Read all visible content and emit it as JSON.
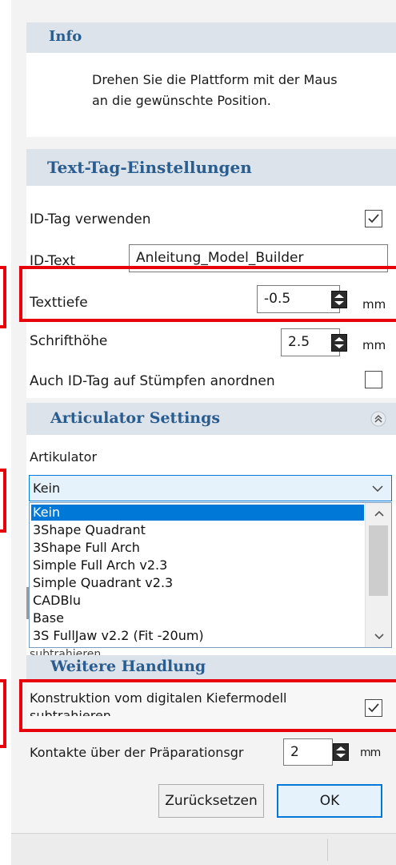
{
  "info": {
    "title": "Info",
    "message_line1": "Drehen Sie die Plattform mit der Maus",
    "message_line2": "an die gewünschte Position."
  },
  "text_tag": {
    "title": "Text-Tag-Einstellungen",
    "use_id_tag_label": "ID-Tag verwenden",
    "use_id_tag_checked": true,
    "id_text_label": "ID-Text",
    "id_text_value": "Anleitung_Model_Builder",
    "text_depth_label": "Texttiefe",
    "text_depth_value": "-0.5",
    "text_depth_unit": "mm",
    "font_height_label": "Schrifthöhe",
    "font_height_value": "2.5",
    "font_height_unit": "mm",
    "id_tag_on_dies_label": "Auch ID-Tag auf Stümpfen anordnen",
    "id_tag_on_dies_checked": false
  },
  "articulator": {
    "title": "Articulator Settings",
    "label": "Artikulator",
    "selected": "Kein",
    "options": [
      "Kein",
      "3Shape Quadrant",
      "3Shape Full Arch",
      "Simple Full Arch v2.3",
      "Simple Quadrant v2.3",
      "CADBlu",
      "Base",
      "3S FullJaw v2.2 (Fit -20um)"
    ],
    "hidden_text": "subtrahieren"
  },
  "further": {
    "title": "Weitere Handlung",
    "subtract_line1": "Konstruktion vom digitalen Kiefermodell",
    "subtract_line2": "subtrahieren",
    "subtract_checked": true,
    "contacts_label": "Kontakte über der Präparationsgr",
    "contacts_value": "2",
    "contacts_unit": "mm"
  },
  "buttons": {
    "reset": "Zurücksetzen",
    "ok": "OK"
  },
  "colors": {
    "header_text": "#2a5d8f",
    "header_bg": "#dde3ea",
    "selection": "#0078d7",
    "highlight": "#e8000b"
  }
}
